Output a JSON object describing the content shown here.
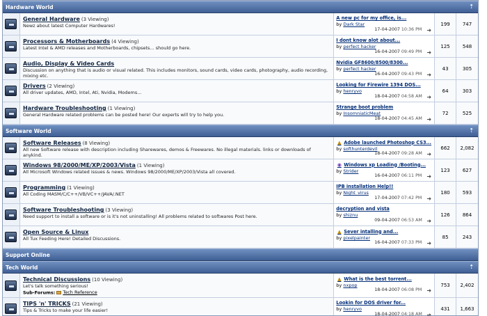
{
  "categories": [
    {
      "name": "Hardware World",
      "forums": [
        {
          "title": "General Hardware",
          "viewing": "(3 Viewing)",
          "description": "Newz about latest Computer Hardwares!",
          "last_post": {
            "title": "A new pc for my office, is...",
            "by": "by",
            "author": "Dark Star",
            "date": "17-04-2007",
            "time": "10:36 PM",
            "icon": ""
          },
          "threads": "199",
          "posts": "747"
        },
        {
          "title": "Processors & Motherboards",
          "viewing": "(4 Viewing)",
          "description": "Latest Intel & AMD releases and Motherboards, chipsets... should go here.",
          "last_post": {
            "title": "I dont know alot about...",
            "by": "by",
            "author": "perfect hacker",
            "date": "16-04-2007",
            "time": "09:49 PM",
            "icon": ""
          },
          "threads": "125",
          "posts": "548"
        },
        {
          "title": "Audio, Display & Video Cards",
          "viewing": "",
          "description": "Discussion on anything that is audio or visual related. This includes monitors, sound cards, video cards, photography, audio recording, mixing etc.",
          "last_post": {
            "title": "Nvidia GF8600/8500/8300...",
            "by": "by",
            "author": "perfect hacker",
            "date": "16-04-2007",
            "time": "09:43 PM",
            "icon": ""
          },
          "threads": "43",
          "posts": "305"
        },
        {
          "title": "Drivers",
          "viewing": "(2 Viewing)",
          "description": "All driver updates, AMD, Intel, Ati, Nvidia, Modems...",
          "last_post": {
            "title": "Looking for Firewire 1394 DOS...",
            "by": "by",
            "author": "henryvo",
            "date": "18-04-2007",
            "time": "04:58 AM",
            "icon": ""
          },
          "threads": "64",
          "posts": "303"
        },
        {
          "title": "Hardware Troubleshooting",
          "viewing": "(1 Viewing)",
          "description": "General Hardware related problems can be posted here! Our experts will try to help you.",
          "last_post": {
            "title": "Strange boot problem",
            "by": "by",
            "author": "InsomniaticMeat",
            "date": "18-04-2007",
            "time": "04:45 AM",
            "icon": ""
          },
          "threads": "72",
          "posts": "525"
        }
      ]
    },
    {
      "name": "Software World",
      "forums": [
        {
          "title": "Software Releases",
          "viewing": "(8 Viewing)",
          "description": "All new Software release with description including Sharewares, demos & Freewares. No illegal materials. links or downloads of anykind.",
          "last_post": {
            "title": "Adobe launched Photoshop CS3...",
            "by": "by",
            "author": "softhunterdevil",
            "date": "18-04-2007",
            "time": "09:28 AM",
            "icon": "warning"
          },
          "threads": "662",
          "posts": "2,082"
        },
        {
          "title": "Windows 98/2000/ME/XP/2003/Vista",
          "viewing": "(1 Viewing)",
          "description": "All Microsoft Windows related issues & news. Windows 98/2000/ME/XP/2003/Vista all covered.",
          "last_post": {
            "title": "Windows xp Loading /Booting...",
            "by": "by",
            "author": "Strider",
            "date": "16-04-2007",
            "time": "06:11 PM",
            "icon": "circle"
          },
          "threads": "123",
          "posts": "627"
        },
        {
          "title": "Programming",
          "viewing": "(1 Viewing)",
          "description": "All Coding MASM/C/C++/VB/VC++/JAVA/.NET",
          "last_post": {
            "title": "IPB installation Help!!",
            "by": "by",
            "author": "Night_virus",
            "date": "17-04-2007",
            "time": "07:42 PM",
            "icon": ""
          },
          "threads": "180",
          "posts": "593"
        },
        {
          "title": "Software Troubleshooting",
          "viewing": "(3 Viewing)",
          "description": "Need support to install a software or is it's not uninstalling! All problems related to softwares Post here.",
          "last_post": {
            "title": "decryption and vista",
            "by": "by",
            "author": "shiznu",
            "date": "09-04-2007",
            "time": "06:53 AM",
            "icon": ""
          },
          "threads": "126",
          "posts": "864"
        },
        {
          "title": "Open Source & Linux",
          "viewing": "",
          "description": "All Tux Feeding Here! Detailed Discussions.",
          "last_post": {
            "title": "Sever intalling and...",
            "by": "by",
            "author": "pixelpainter",
            "date": "16-04-2007",
            "time": "07:33 PM",
            "icon": "warning"
          },
          "threads": "85",
          "posts": "243"
        }
      ]
    },
    {
      "name": "Support Online",
      "forums": []
    },
    {
      "name": "Tech World",
      "forums": [
        {
          "title": "Technical Discussions",
          "viewing": "(10 Viewing)",
          "description": "Let's talk something serious!",
          "subforums_label": "Sub-Forums:",
          "subforum": "Tech Reference",
          "last_post": {
            "title": "What is the best torrent...",
            "by": "by",
            "author": "nxpop",
            "date": "18-04-2007",
            "time": "06:08 PM",
            "icon": "warning"
          },
          "threads": "753",
          "posts": "2,402"
        },
        {
          "title": "TIPS 'n' TRICKS",
          "viewing": "(21 Viewing)",
          "description": "Tips & Tricks to make your life easier!",
          "last_post": {
            "title": "Lookin for DOS driver for...",
            "by": "by",
            "author": "henryvo",
            "date": "18-04-2007",
            "time": "04:18 AM",
            "icon": ""
          },
          "threads": "431",
          "posts": "1,663"
        }
      ]
    }
  ],
  "ui": {
    "collapse_icon": "collapse-icon",
    "jump_icon": "jump-to-last-post-icon",
    "forum_icon": "forum-folder-icon"
  }
}
